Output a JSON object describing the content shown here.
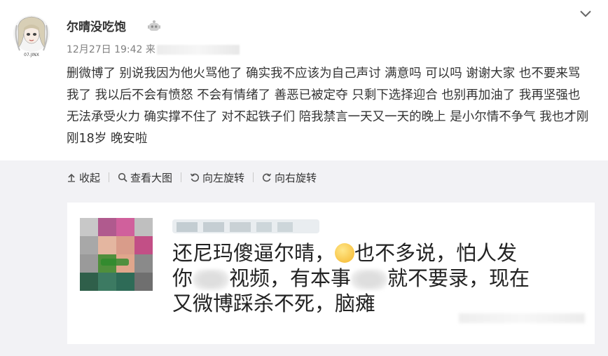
{
  "post": {
    "username": "尔晴没吃饱",
    "avatar_caption": "07.JINX",
    "timestamp": "12月27日 19:42",
    "source_prefix": "来",
    "text": "删微博了 别说我因为他火骂他了 确实我不应该为自己声讨 满意吗 可以吗 谢谢大家 也不要来骂我了 我以后不会有愤怒 不会有情绪了 善恶已被定夺 只剩下选择迎合 也别再加油了 我再坚强也无法承受火力 确实撑不住了 对不起铁子们 陪我禁言一天又一天的晚上 是小尔情不争气 我也才刚刚18岁 晚安啦",
    "icons": {
      "badge": "robot-badge-icon",
      "menu": "chevron-down-icon"
    }
  },
  "toolbar": {
    "items": [
      {
        "label": "收起",
        "icon": "arrow-up-icon"
      },
      {
        "label": "查看大图",
        "icon": "search-icon"
      },
      {
        "label": "向左旋转",
        "icon": "rotate-left-icon"
      },
      {
        "label": "向右旋转",
        "icon": "rotate-right-icon"
      }
    ]
  },
  "embedded_image": {
    "line1_a": "还尼玛傻逼尔晴，",
    "line1_b": "也不多说，怕人发",
    "line2_a": "你",
    "line2_b": "视频，有本事",
    "line2_c": "就不要录，现在",
    "line3": "又微博踩杀不死，脑瘫"
  },
  "colors": {
    "panel_bg": "#f2f2f5",
    "text": "#333333",
    "meta": "#808080"
  }
}
